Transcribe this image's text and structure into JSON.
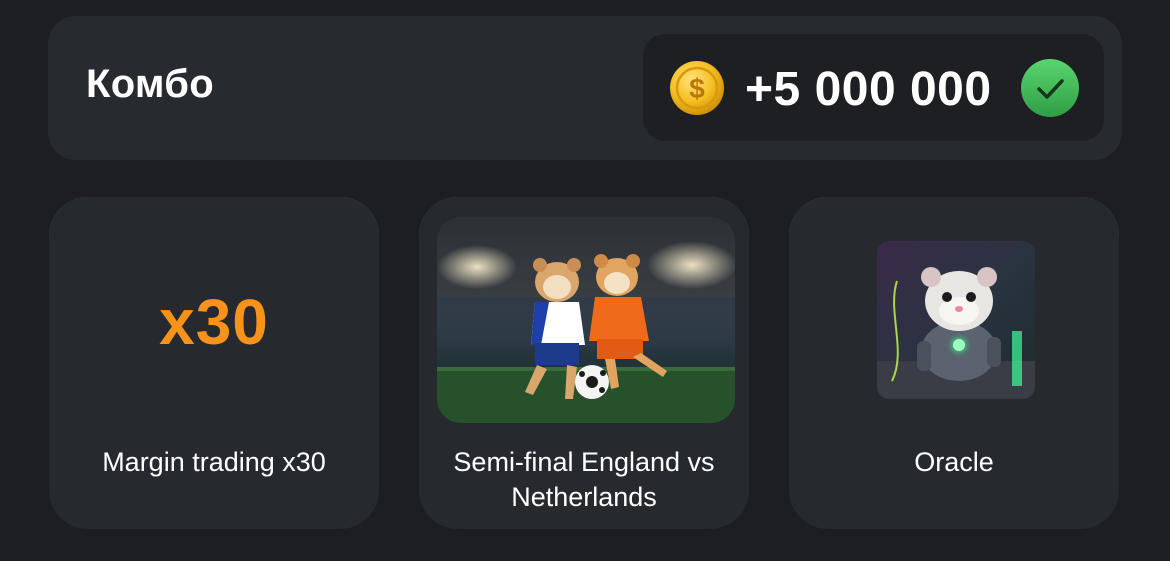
{
  "combo": {
    "title": "Комбо",
    "reward": "+5 000 000",
    "coin_icon": "gold-dollar-coin-icon",
    "status_icon": "green-check-icon",
    "colors": {
      "coin": "#f5b800",
      "check": "#3ec25a",
      "accent_border": "#4caf50"
    }
  },
  "cards": [
    {
      "badge_text": "x30",
      "badge_color": "#f7931a",
      "label": "Margin trading x30"
    },
    {
      "image": "hamsters-playing-football",
      "label": "Semi-final England vs Netherlands"
    },
    {
      "image": "robot-hamster-oracle",
      "label": "Oracle"
    }
  ]
}
